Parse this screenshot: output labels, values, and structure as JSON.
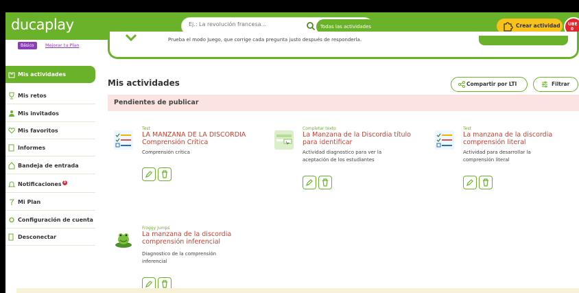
{
  "header": {
    "logo": "ducaplay",
    "search_placeholder": "Ej.: La revolución francesa...",
    "search_scope": "Todas las actividades",
    "create_label": "Crear actividad",
    "avatar_text": "UBE",
    "avatar_badge": "0"
  },
  "plan": {
    "badge": "Básico",
    "upgrade_link": "Mejorar tu Plan"
  },
  "banner": {
    "text": "Prueba el modo Juego, que corrige cada pregunta justo después de responderla."
  },
  "sidebar": {
    "items": [
      {
        "label": "Mis actividades",
        "icon": "puzzle-icon",
        "active": true
      },
      {
        "label": "Mis retos",
        "icon": "trophy-icon"
      },
      {
        "label": "Mis invitados",
        "icon": "users-icon"
      },
      {
        "label": "Mis favoritos",
        "icon": "heart-icon"
      },
      {
        "label": "Informes",
        "icon": "report-icon"
      },
      {
        "label": "Bandeja de entrada",
        "icon": "inbox-icon"
      },
      {
        "label": "Notificaciones",
        "icon": "bell-icon",
        "badge": "3"
      },
      {
        "label": "Mi Plan",
        "icon": "plan-icon"
      },
      {
        "label": "Configuración de cuenta",
        "icon": "settings-icon"
      },
      {
        "label": "Desconectar",
        "icon": "logout-icon"
      }
    ]
  },
  "main": {
    "title": "Mis actividades",
    "share_lti_label": "Compartir por LTI",
    "filter_label": "Filtrar",
    "section_title": "Pendientes de publicar",
    "cards": [
      {
        "type": "Test",
        "title_lines": [
          "LA MANZANA DE LA DISCORDIA",
          "Comprensión Crítica"
        ],
        "desc_lines": [
          "Comprensión crítica"
        ],
        "thumb": "test-icon"
      },
      {
        "type": "Completar texto",
        "title_lines": [
          "La Manzana de la Discordia título",
          "para identificar"
        ],
        "desc_lines": [
          "Actividad diagnostico para ver la",
          "aceptación de los estudiantes"
        ],
        "thumb": "fill-text-icon"
      },
      {
        "type": "Test",
        "title_lines": [
          "La manzana de la discordia",
          "comprensión literal"
        ],
        "desc_lines": [
          "Actividad para desarrollar la",
          "comprensión literal"
        ],
        "thumb": "test-icon"
      },
      {
        "type": "Froggy Jumps",
        "title_lines": [
          "La manzana de la discordia",
          "comprensión inferencial"
        ],
        "desc_lines": [
          "Diagnostico de la comprensión",
          "inferencial"
        ],
        "thumb": "frog-icon"
      }
    ]
  },
  "colors": {
    "brand": "#6bb22b",
    "accent_yellow": "#f7c21c",
    "title_red": "#c94132",
    "pending_bg": "#fbe3e1",
    "plan_purple": "#8a3fb8"
  }
}
